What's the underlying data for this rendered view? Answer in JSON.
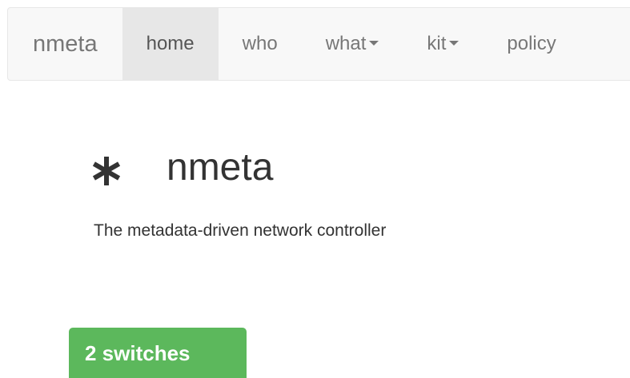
{
  "navbar": {
    "brand": "nmeta",
    "items": [
      {
        "label": "home",
        "active": true,
        "dropdown": false
      },
      {
        "label": "who",
        "active": false,
        "dropdown": false
      },
      {
        "label": "what",
        "active": false,
        "dropdown": true
      },
      {
        "label": "kit",
        "active": false,
        "dropdown": true
      },
      {
        "label": "policy",
        "active": false,
        "dropdown": false
      }
    ]
  },
  "hero": {
    "icon": "asterisk-icon",
    "title": "nmeta",
    "subtitle": "The metadata-driven network controller"
  },
  "status": {
    "switches_label": "2 switches",
    "color": "#5cb85c"
  }
}
